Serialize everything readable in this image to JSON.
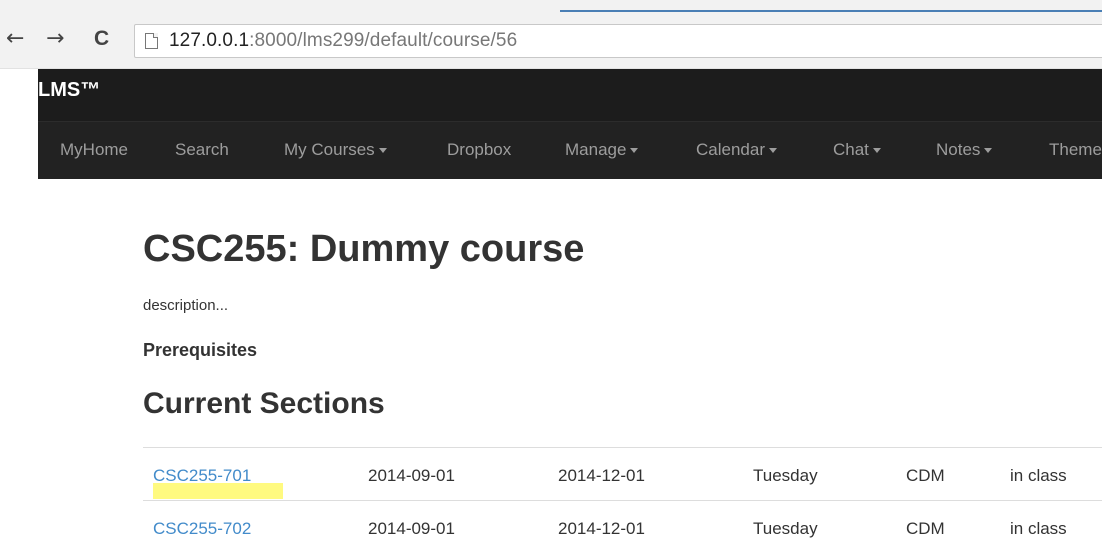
{
  "browser": {
    "back_icon": "←",
    "forward_icon": "→",
    "reload_icon": "C",
    "url_host": "127.0.0.1",
    "url_rest": ":8000/lms299/default/course/56"
  },
  "navbar": {
    "brand": "LMS™",
    "items": [
      {
        "label": "MyHome",
        "dropdown": false
      },
      {
        "label": "Search",
        "dropdown": false
      },
      {
        "label": "My Courses",
        "dropdown": true
      },
      {
        "label": "Dropbox",
        "dropdown": false
      },
      {
        "label": "Manage",
        "dropdown": true
      },
      {
        "label": "Calendar",
        "dropdown": true
      },
      {
        "label": "Chat",
        "dropdown": true
      },
      {
        "label": "Notes",
        "dropdown": true
      },
      {
        "label": "Theme",
        "dropdown": false
      }
    ]
  },
  "course": {
    "title": "CSC255: Dummy course",
    "description": "description...",
    "prerequisites_heading": "Prerequisites",
    "sections_heading": "Current Sections"
  },
  "sections": [
    {
      "code": "CSC255-701",
      "start": "2014-09-01",
      "end": "2014-12-01",
      "day": "Tuesday",
      "location": "CDM",
      "mode": "in class"
    },
    {
      "code": "CSC255-702",
      "start": "2014-09-01",
      "end": "2014-12-01",
      "day": "Tuesday",
      "location": "CDM",
      "mode": "in class"
    }
  ],
  "colors": {
    "navbar_bg": "#222222",
    "brand_bar_bg": "#1c1c1c",
    "link": "#428bca",
    "highlight": "#fff96a"
  }
}
